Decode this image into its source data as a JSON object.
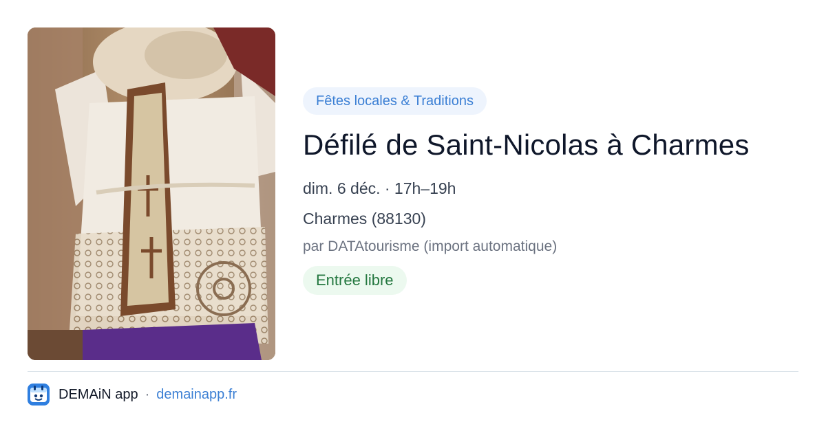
{
  "event": {
    "image_alt": "Saint-Nicolas costume",
    "category": "Fêtes locales & Traditions",
    "title": "Défilé de Saint-Nicolas à Charmes",
    "when": "dim. 6 déc. · 17h–19h",
    "where": "Charmes (88130)",
    "source": "par DATAtourisme (import automatique)",
    "price": "Entrée libre"
  },
  "footer": {
    "app_name": "DEMAiN app",
    "separator": "·",
    "link": "demainapp.fr"
  },
  "colors": {
    "category_bg": "#eef4fd",
    "category_text": "#3b7fd4",
    "price_bg": "#ecf9ef",
    "price_text": "#23773f",
    "link": "#3b7fd4",
    "logo_bg": "#2f7fe0"
  },
  "icons": {
    "app_logo": "demain-logo-icon"
  }
}
